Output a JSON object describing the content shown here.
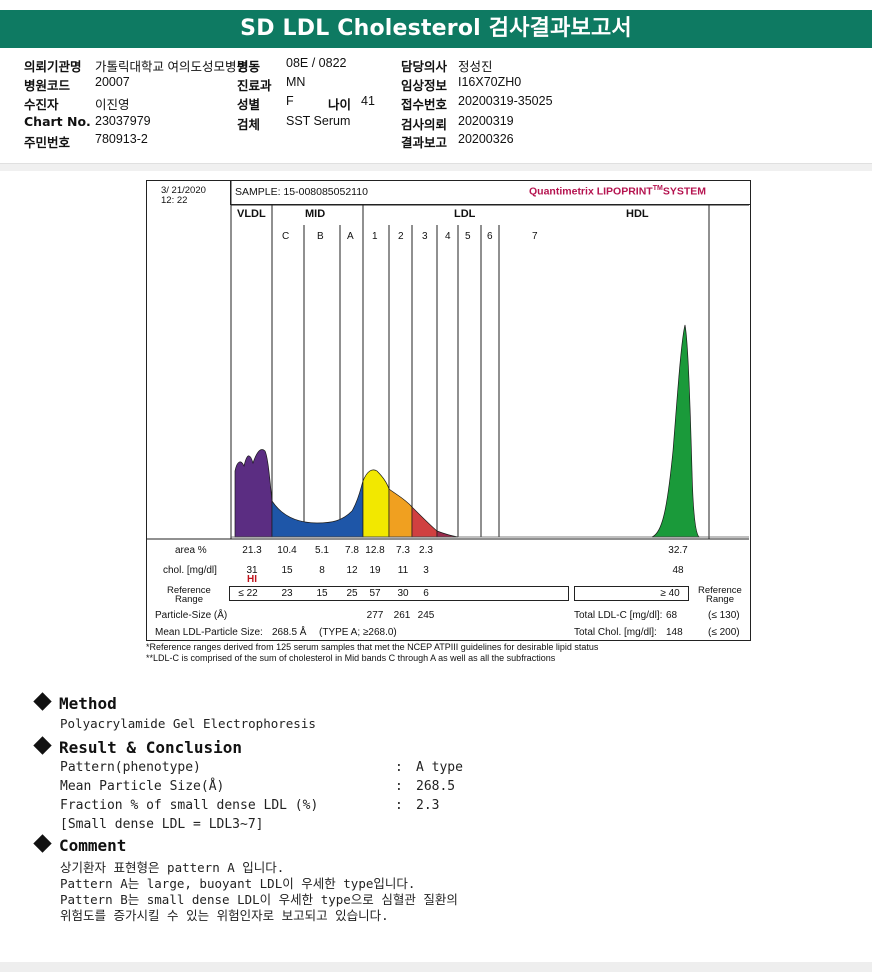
{
  "title": "SD LDL Cholesterol 검사결과보고서",
  "info": {
    "col1": [
      {
        "label": "의뢰기관명",
        "value": "가톨릭대학교 여의도성모병원"
      },
      {
        "label": "병원코드",
        "value": "20007"
      },
      {
        "label": "수진자",
        "value": "이진영"
      },
      {
        "label": "Chart No.",
        "value": "23037979"
      },
      {
        "label": "주민번호",
        "value": "780913-2"
      }
    ],
    "col2": [
      {
        "label": "병동",
        "value": "08E / 0822"
      },
      {
        "label": "진료과",
        "value": "MN"
      },
      {
        "label": "성별",
        "value": "F"
      },
      {
        "label": "검체",
        "value": "SST Serum"
      }
    ],
    "age": {
      "label": "나이",
      "value": "41"
    },
    "col3": [
      {
        "label": "담당의사",
        "value": "정성진"
      },
      {
        "label": "임상정보",
        "value": "I16X70ZH0"
      },
      {
        "label": "접수번호",
        "value": "20200319-35025"
      },
      {
        "label": "검사의뢰",
        "value": "20200319"
      },
      {
        "label": "결과보고",
        "value": "20200326"
      }
    ]
  },
  "report": {
    "date": "3/ 21/2020",
    "time": "12: 22",
    "sample": "SAMPLE:   15-008085052110",
    "brand_a": "Quantimetrix LIPOPRINT",
    "brand_tm": "TM",
    "brand_b": "SYSTEM",
    "groups": [
      "VLDL",
      "MID",
      "LDL",
      "HDL"
    ],
    "bands": [
      "C",
      "B",
      "A",
      "1",
      "2",
      "3",
      "4",
      "5",
      "6",
      "7"
    ],
    "area_label": "area %",
    "area": [
      "21.3",
      "10.4",
      "5.1",
      "7.8",
      "12.8",
      "7.3",
      "2.3"
    ],
    "area_hdl": "32.7",
    "chol_label": "chol. [mg/dl]",
    "chol": [
      "31",
      "15",
      "8",
      "12",
      "19",
      "11",
      "3"
    ],
    "chol_hdl": "48",
    "hi_flag": "HI",
    "ref_label_1": "Reference",
    "ref_label_2": "Range",
    "ref": [
      "≤ 22",
      "23",
      "15",
      "25",
      "57",
      "30",
      "6"
    ],
    "ref_hdl": "≥ 40",
    "ref_right_1": "Reference",
    "ref_right_2": "Range",
    "particle_label": "Particle-Size (Å)",
    "particle": [
      "277",
      "261",
      "245"
    ],
    "total_ldl_label": "Total LDL-C [mg/dl]:",
    "total_ldl": "68",
    "total_ldl_ref": "(≤ 130)",
    "mean_label": "Mean LDL-Particle Size:",
    "mean_value": "268.5 Å",
    "mean_type": "(TYPE A; ≥268.0)",
    "total_chol_label": "Total Chol. [mg/dl]:",
    "total_chol": "148",
    "total_chol_ref": "(≤ 200)"
  },
  "footnote": {
    "line1": "*Reference ranges derived from 125 serum samples that met the NCEP ATPIII guidelines for desirable lipid status",
    "line2": "**LDL-C is comprised of the sum of cholesterol in Mid bands C through A as well as all the subfractions"
  },
  "method": {
    "heading": "Method",
    "text": "Polyacrylamide Gel Electrophoresis"
  },
  "result": {
    "heading": "Result & Conclusion",
    "rows": [
      {
        "k": "Pattern(phenotype)",
        "sep": ":",
        "v": "A type"
      },
      {
        "k": "Mean Particle Size(Å)",
        "sep": ":",
        "v": "268.5"
      },
      {
        "k": "Fraction % of small dense LDL (%)",
        "sep": ":",
        "v": "2.3"
      }
    ],
    "note": "[Small dense LDL = LDL3~7]"
  },
  "comment": {
    "heading": "Comment",
    "lines": [
      "상기환자 표현형은 pattern A 입니다.",
      "Pattern A는 large, buoyant LDL이 우세한 type입니다.",
      "Pattern B는 small dense LDL이 우세한 type으로 심혈관 질환의",
      "위험도를 증가시킬 수 있는 위험인자로 보고되고 있습니다."
    ]
  },
  "colors": {
    "banner": "#0e7a62",
    "vldl": "#5b2d82",
    "mid": "#1e56a8",
    "ldl1": "#f2e800",
    "ldl2": "#f0a020",
    "ldl3": "#d04040",
    "hdl": "#1a9a3a",
    "brand": "#b5134f"
  }
}
